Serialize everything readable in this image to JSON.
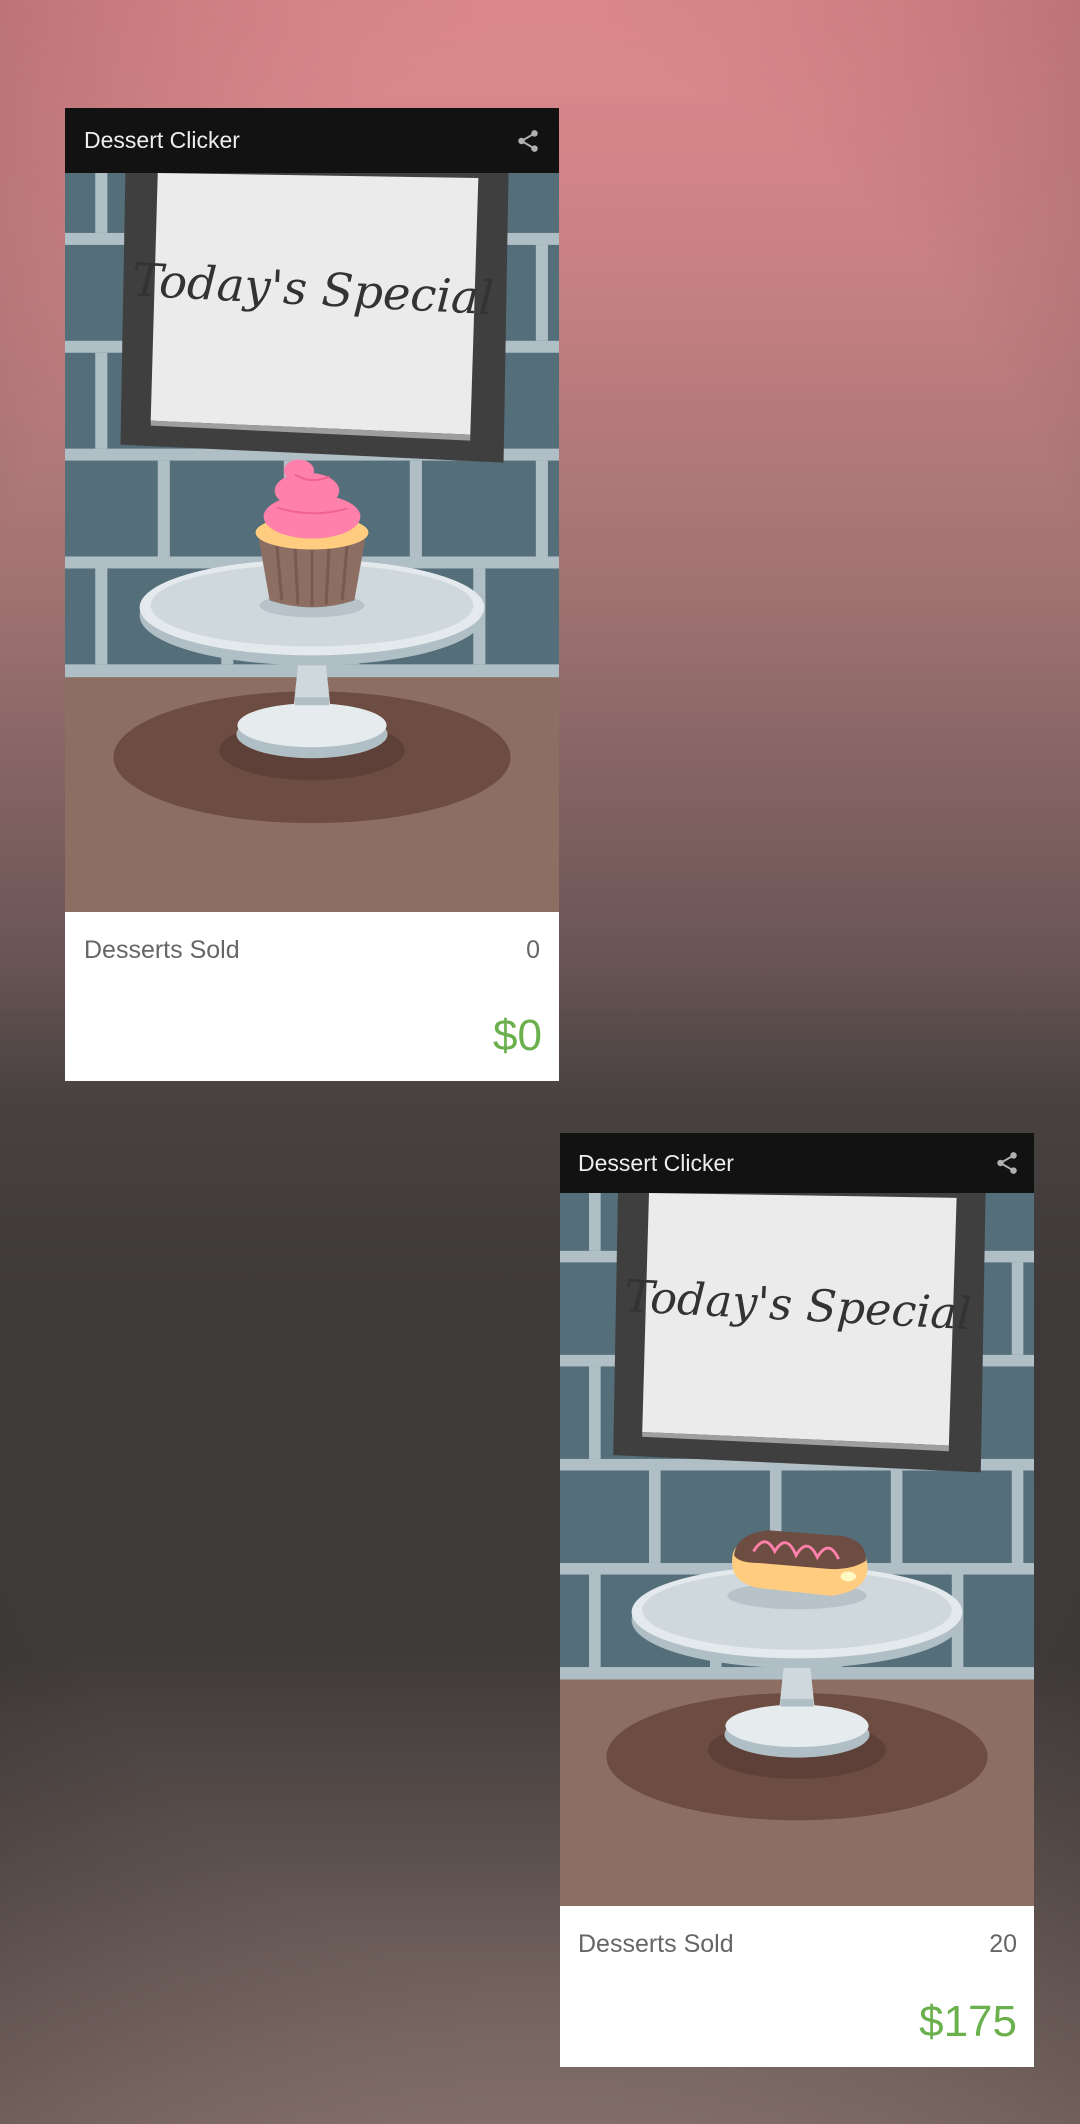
{
  "screens": [
    {
      "app_title": "Dessert Clicker",
      "share_icon": "share-icon",
      "sign_text": "Today's Special",
      "dessert": "cupcake",
      "desserts_sold_label": "Desserts Sold",
      "desserts_sold": "0",
      "revenue": "$0"
    },
    {
      "app_title": "Dessert Clicker",
      "share_icon": "share-icon",
      "sign_text": "Today's Special",
      "dessert": "eclair",
      "desserts_sold_label": "Desserts Sold",
      "desserts_sold": "20",
      "revenue": "$175"
    }
  ],
  "colors": {
    "app_bar": "#121212",
    "wall": "#546e7a",
    "mortar": "#b0bec5",
    "floor": "#8d6e63",
    "revenue_green": "#6ab04c",
    "frosting_pink": "#ff80ab"
  }
}
